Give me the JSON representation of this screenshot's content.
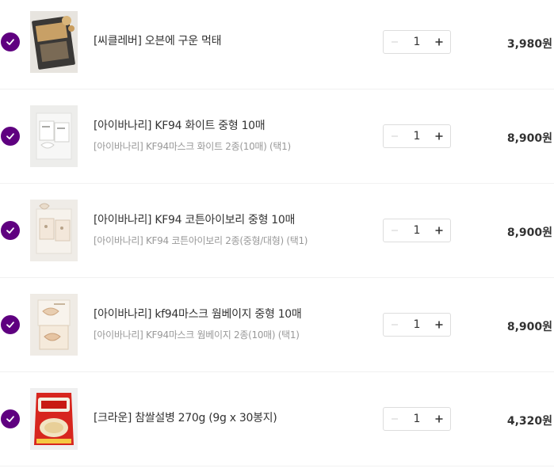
{
  "cart": {
    "items": [
      {
        "checked": true,
        "name": "[씨클레버] 오븐에 구운 먹태",
        "option": "",
        "quantity": "1",
        "price": "3,980원",
        "thumb_icon": "dried-pollack-pack-thumbnail"
      },
      {
        "checked": true,
        "name": "[아이바나리] KF94 화이트 중형 10매",
        "option": "[아이바나리] KF94마스크 화이트 2종(10매) (택1)",
        "quantity": "1",
        "price": "8,900원",
        "thumb_icon": "white-mask-thumbnail"
      },
      {
        "checked": true,
        "name": "[아이바나리] KF94 코튼아이보리 중형 10매",
        "option": "[아이바나리] KF94 코튼아이보리 2종(중형/대형) (택1)",
        "quantity": "1",
        "price": "8,900원",
        "thumb_icon": "ivory-mask-thumbnail"
      },
      {
        "checked": true,
        "name": "[아이바나리] kf94마스크 웜베이지 중형 10매",
        "option": "[아이바나리] KF94마스크 웜베이지 2종(10매) (택1)",
        "quantity": "1",
        "price": "8,900원",
        "thumb_icon": "beige-mask-thumbnail"
      },
      {
        "checked": true,
        "name": "[크라운] 참쌀설병 270g (9g x 30봉지)",
        "option": "",
        "quantity": "1",
        "price": "4,320원",
        "thumb_icon": "rice-cracker-pack-thumbnail"
      }
    ]
  },
  "colors": {
    "accent": "#5f0080",
    "text": "#333333",
    "subtext": "#999999",
    "divider": "#f1f1f1",
    "stepper_border": "#dddddd",
    "minus_disabled": "#dddddd"
  }
}
